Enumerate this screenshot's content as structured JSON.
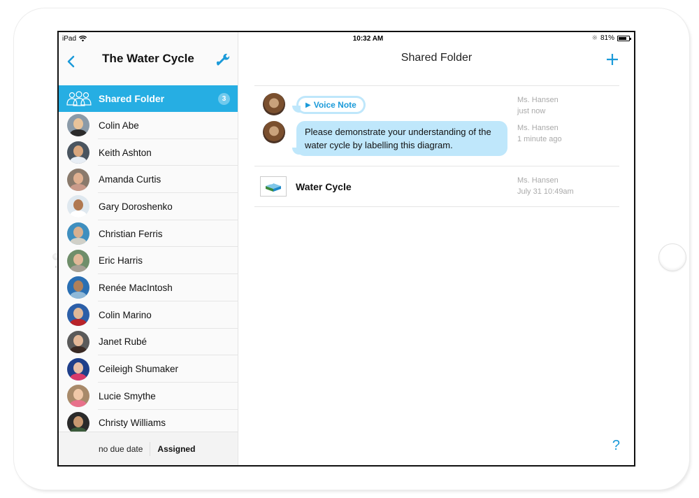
{
  "status_bar": {
    "device": "iPad",
    "time": "10:32 AM",
    "battery_percent": "81%",
    "battery_level": 0.81
  },
  "sidebar": {
    "title": "The Water Cycle",
    "back_icon": "chevron-left-icon",
    "settings_icon": "wrench-icon",
    "shared_folder": {
      "label": "Shared Folder",
      "badge": "3",
      "icon": "group-icon"
    },
    "students": [
      {
        "name": "Colin Abe"
      },
      {
        "name": "Keith Ashton"
      },
      {
        "name": "Amanda Curtis"
      },
      {
        "name": "Gary Doroshenko"
      },
      {
        "name": "Christian Ferris"
      },
      {
        "name": "Eric Harris"
      },
      {
        "name": "Renée MacIntosh"
      },
      {
        "name": "Colin Marino"
      },
      {
        "name": "Janet Rubé"
      },
      {
        "name": "Ceileigh Shumaker"
      },
      {
        "name": "Lucie Smythe"
      },
      {
        "name": "Christy Williams"
      }
    ],
    "footer": {
      "due_date": "no due date",
      "status": "Assigned"
    }
  },
  "main": {
    "title": "Shared Folder",
    "add_icon": "plus-icon",
    "messages": [
      {
        "type": "voice",
        "label": "Voice Note",
        "author": "Ms. Hansen",
        "time": "just now"
      },
      {
        "type": "text",
        "text": "Please demonstrate your understanding of the water cycle by labelling this diagram.",
        "author": "Ms. Hansen",
        "time": "1 minute ago"
      }
    ],
    "file": {
      "name": "Water Cycle",
      "author": "Ms. Hansen",
      "time": "July 31 10:49am"
    },
    "help_label": "?"
  },
  "colors": {
    "accent": "#1a9ad9",
    "selected_row": "#26aee3",
    "bubble": "#bfe7fb"
  }
}
